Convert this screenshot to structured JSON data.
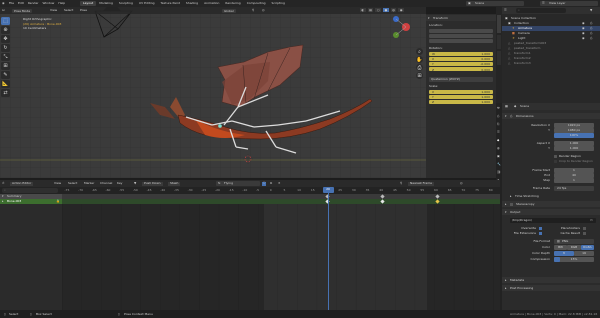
{
  "menu": {
    "items": [
      "File",
      "Edit",
      "Render",
      "Window",
      "Help"
    ]
  },
  "workspaces": [
    "Layout",
    "Modeling",
    "Sculpting",
    "UV Editing",
    "Texture Paint",
    "Shading",
    "Animation",
    "Rendering",
    "Compositing",
    "Scripting"
  ],
  "active_workspace": "Layout",
  "top_right": {
    "scene": "Scene",
    "view_layer": "View Layer"
  },
  "viewport": {
    "mode": "Pose Mode",
    "menus": [
      "View",
      "Select",
      "Pose"
    ],
    "transform": "Global",
    "overlay_lines": [
      "Right Orthographic",
      "(20) Armature : Bone.003",
      "10 Centimeters"
    ]
  },
  "npanel": {
    "title": "Transform",
    "location_label": "Location:",
    "rotation_label": "Rotation:",
    "rotation_rows": [
      {
        "axis": "W",
        "value": "1.000"
      },
      {
        "axis": "X",
        "value": "0.000"
      },
      {
        "axis": "Y",
        "value": "-0.000"
      },
      {
        "axis": "Z",
        "value": "0.000"
      }
    ],
    "mode_label": "Quaternion (WXYZ)",
    "scale_label": "Scale:",
    "scale_rows": [
      {
        "axis": "X",
        "value": "1.000"
      },
      {
        "axis": "Y",
        "value": "1.000"
      },
      {
        "axis": "Z",
        "value": "1.000"
      }
    ]
  },
  "outliner": {
    "root": "Scene Collection",
    "items": [
      "Collection",
      "Armature",
      "Camera",
      "Light",
      "pasted_transform003",
      "pasted_transform",
      "transform1",
      "transform2",
      "transform3"
    ]
  },
  "properties": {
    "context": "Scene",
    "sections": {
      "dimensions": "Dimensions",
      "output": "Output",
      "metadata": "Metadata",
      "post": "Post Processing",
      "stereo": "Stereoscopy",
      "time_stretching": "Time Stretching"
    },
    "res_x_label": "Resolution X",
    "res_x": "1920 px",
    "res_y_label": "Y",
    "res_y": "1080 px",
    "res_pct": "100%",
    "aspect_x_label": "Aspect X",
    "aspect_x": "1.000",
    "aspect_y_label": "Y",
    "aspect_y": "1.000",
    "render_region": "Render Region",
    "crop": "Crop to Render Region",
    "frame_start_label": "Frame Start",
    "frame_start": "1",
    "end_label": "End",
    "frame_end": "40",
    "step_label": "Step",
    "frame_step": "1",
    "frame_rate_label": "Frame Rate",
    "frame_rate": "24 fps",
    "output_path": "/tmp/Dragon/",
    "overwrite": "Overwrite",
    "placeholders": "Placeholders",
    "file_ext": "File Extensions",
    "cache_result": "Cache Result",
    "file_format_label": "File Format",
    "file_format": "PNG",
    "color_label": "Color",
    "color_opts": [
      "BW",
      "RGB",
      "RGBA"
    ],
    "color_depth_label": "Color Depth",
    "depth_opts": [
      "8",
      "16"
    ],
    "compression_label": "Compression",
    "compression": "15%"
  },
  "timeline": {
    "editor": "Action Editor",
    "menus": [
      "View",
      "Select",
      "Marker",
      "Channel",
      "Key"
    ],
    "push_down": "Push Down",
    "stash": "Stash",
    "action": "Flying",
    "interp": "Nearest Frame",
    "channels": [
      {
        "name": "Summary"
      },
      {
        "name": "Bone.003"
      }
    ],
    "ruler_labels": [
      "-75",
      "-70",
      "-65",
      "-60",
      "-55",
      "-50",
      "-45",
      "-40",
      "-35",
      "-30",
      "-25",
      "-20",
      "-15",
      "-10",
      "-5",
      "0",
      "5",
      "10",
      "15",
      "20",
      "25",
      "30",
      "35",
      "40",
      "45",
      "50",
      "55",
      "60",
      "65",
      "70",
      "75",
      "80"
    ],
    "current_frame": "20",
    "key_frames": [
      20,
      40,
      60
    ]
  },
  "status": {
    "select": "Select",
    "box_select": "Box Select",
    "menu": "Pose Context Menu",
    "info": "Armature | Bone.003 | Verts: 0 | Mem: 22.8 MiB | v2.81.16"
  }
}
